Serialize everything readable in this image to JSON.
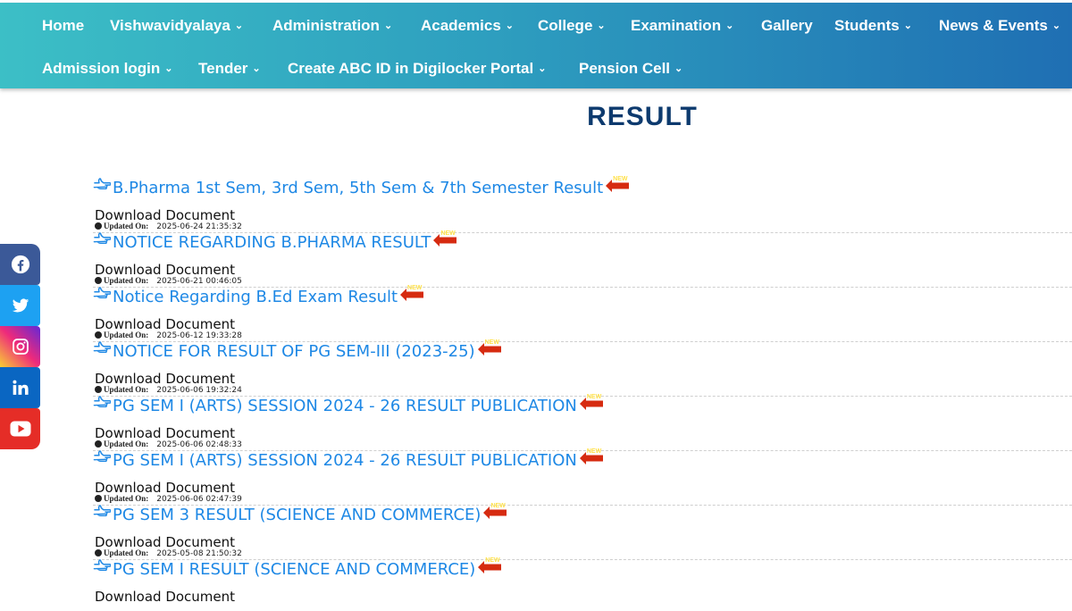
{
  "nav": {
    "row1": [
      {
        "label": "Home",
        "caret": false
      },
      {
        "label": "Vishwavidyalaya",
        "caret": true
      },
      {
        "label": "Administration",
        "caret": true
      },
      {
        "label": "Academics",
        "caret": true
      },
      {
        "label": "College",
        "caret": true
      },
      {
        "label": "Examination",
        "caret": true
      },
      {
        "label": "Gallery",
        "caret": false
      },
      {
        "label": "Students",
        "caret": true
      },
      {
        "label": "News & Events",
        "caret": true
      }
    ],
    "row2": [
      {
        "label": "Admission login",
        "caret": true
      },
      {
        "label": "Tender",
        "caret": true
      },
      {
        "label": "Create ABC ID in Digilocker Portal",
        "caret": true
      },
      {
        "label": "Pension Cell",
        "caret": true
      }
    ]
  },
  "page": {
    "title": "RESULT"
  },
  "results": {
    "download_label": "Download Document",
    "updated_label": "Updated On:",
    "items": [
      {
        "title": "B.Pharma 1st Sem, 3rd Sem, 5th Sem & 7th Semester Result",
        "updated": "2025-06-24 21:35:32"
      },
      {
        "title": "NOTICE REGARDING B.PHARMA RESULT",
        "updated": "2025-06-21 00:46:05"
      },
      {
        "title": "Notice Regarding B.Ed Exam Result",
        "updated": "2025-06-12 19:33:28"
      },
      {
        "title": "NOTICE FOR RESULT OF PG SEM-III (2023-25)",
        "updated": "2025-06-06 19:32:24"
      },
      {
        "title": "PG SEM I (ARTS) SESSION 2024 - 26 RESULT PUBLICATION",
        "updated": "2025-06-06 02:48:33"
      },
      {
        "title": "PG SEM I (ARTS) SESSION 2024 - 26 RESULT PUBLICATION",
        "updated": "2025-06-06 02:47:39"
      },
      {
        "title": "PG SEM 3 RESULT (SCIENCE AND COMMERCE)",
        "updated": "2025-05-08 21:50:32"
      },
      {
        "title": "PG SEM I RESULT (SCIENCE AND COMMERCE)",
        "updated": ""
      }
    ],
    "new_badge": "NEW"
  },
  "social": [
    {
      "name": "facebook-icon"
    },
    {
      "name": "twitter-icon"
    },
    {
      "name": "instagram-icon"
    },
    {
      "name": "linkedin-icon"
    },
    {
      "name": "youtube-icon"
    }
  ],
  "colors": {
    "nav_gradient_start": "#3cbfc6",
    "nav_gradient_end": "#1f6fb3",
    "title": "#0d3a6e",
    "link": "#1e88e5"
  }
}
